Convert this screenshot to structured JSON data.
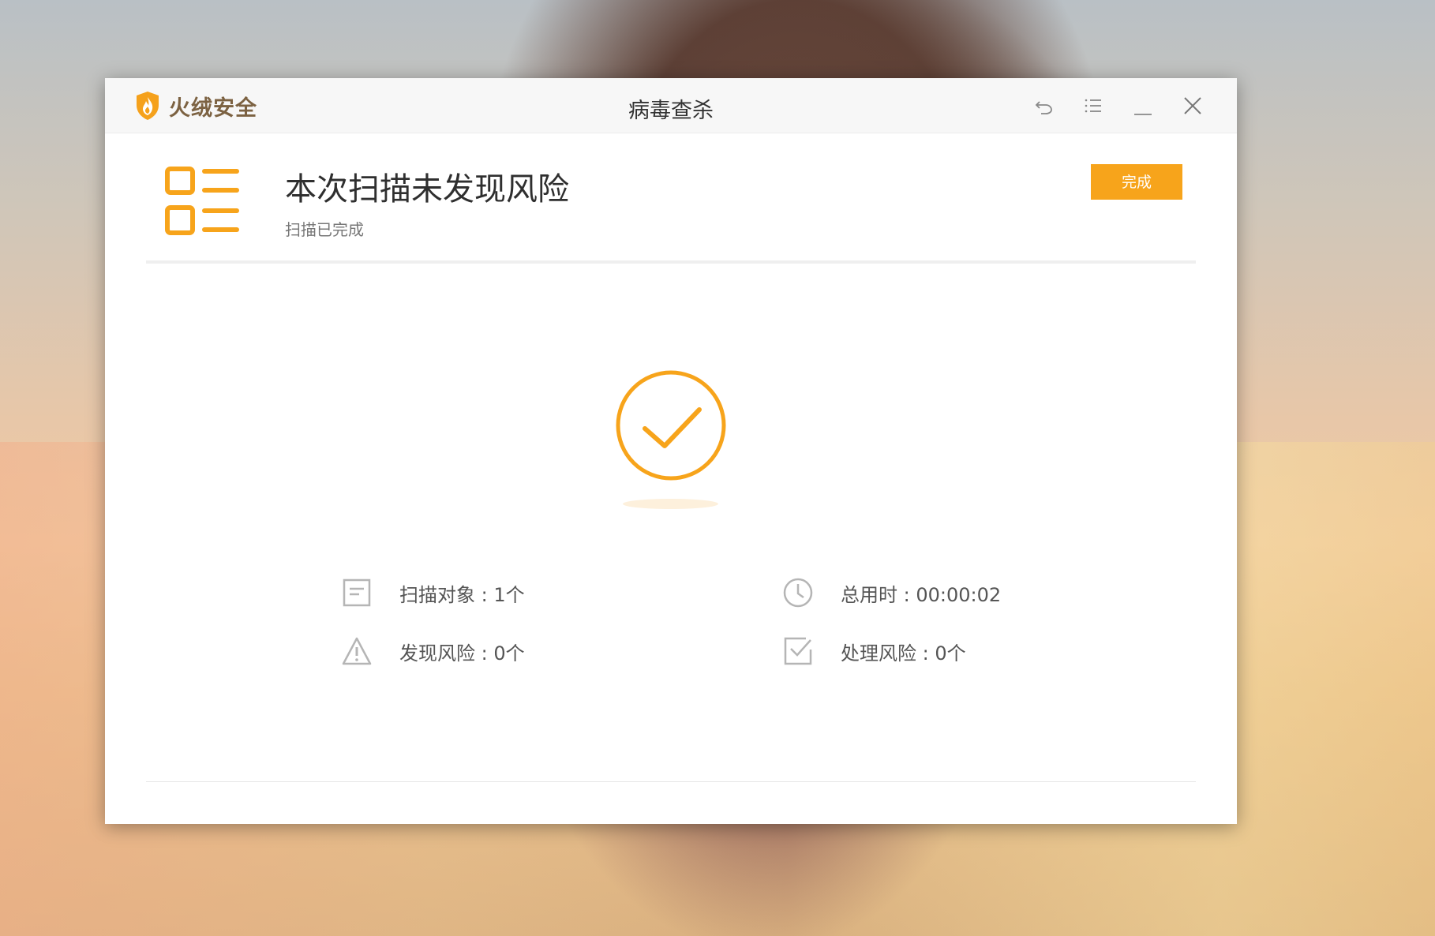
{
  "colors": {
    "accent": "#f7a41b",
    "brand_text": "#7c6242",
    "icon_gray": "#b5b5b5"
  },
  "titlebar": {
    "brand_name": "火绒安全",
    "title": "病毒查杀",
    "icons": [
      "back-icon",
      "menu-icon",
      "minimize-icon",
      "close-icon"
    ]
  },
  "result": {
    "headline": "本次扫描未发现风险",
    "subline": "扫描已完成",
    "done_label": "完成",
    "status_icon": "check-circle-icon"
  },
  "stats": {
    "scanned": "扫描对象 : 1个",
    "duration": "总用时 : 00:00:02",
    "found": "发现风险 : 0个",
    "handled": "处理风险 : 0个"
  }
}
